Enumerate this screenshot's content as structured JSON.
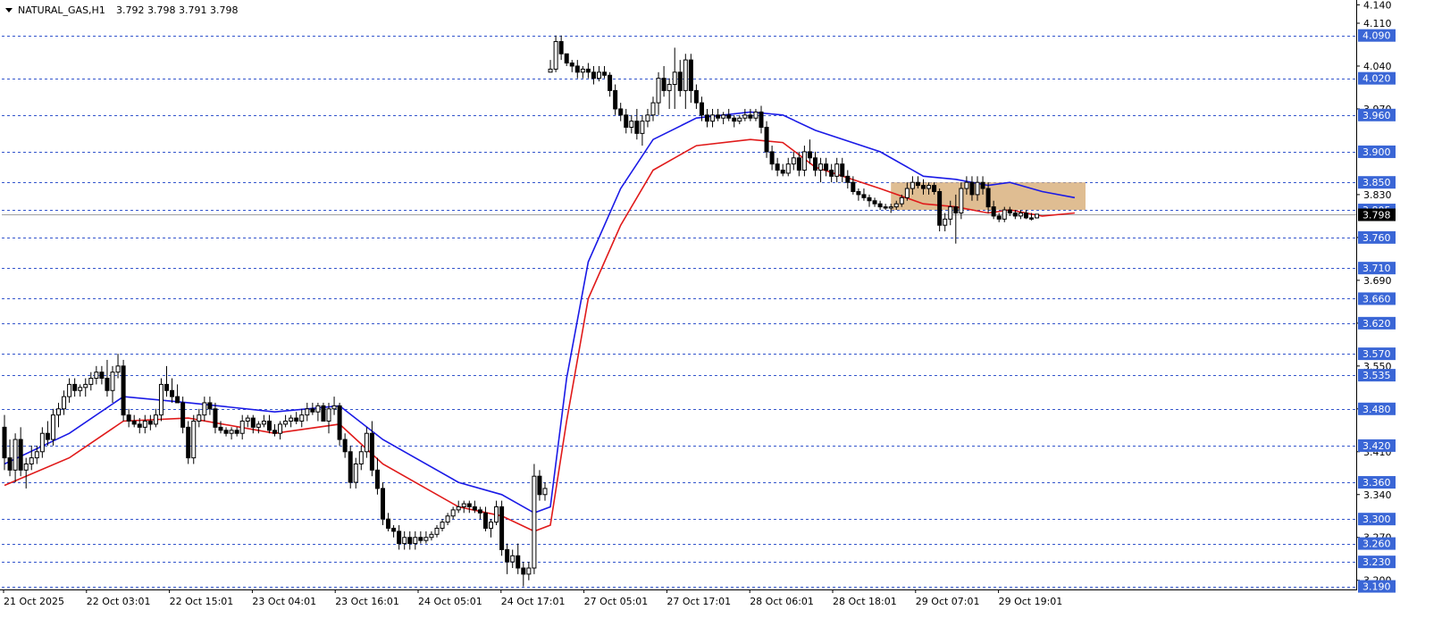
{
  "header": {
    "symbol": "NATURAL_GAS,H1",
    "ohlc": "3.792 3.798 3.791 3.798"
  },
  "colors": {
    "background": "#ffffff",
    "level_line": "#3355cc",
    "level_badge": "#3a66d6",
    "ema_fast": "#1a1ae6",
    "ema_slow": "#e01a1a",
    "zone_fill": "#d9b27f",
    "candle_bull": "#ffffff",
    "candle_bear": "#000000",
    "axis": "#000000",
    "bid_line": "#a0a0a0"
  },
  "chart_data": {
    "type": "candlestick",
    "ylim": [
      3.185,
      4.145
    ],
    "y_ticks": [
      "4.140",
      "4.110",
      "4.040",
      "3.970",
      "3.830",
      "3.760",
      "3.690",
      "3.620",
      "3.550",
      "3.480",
      "3.410",
      "3.340",
      "3.270",
      "3.200"
    ],
    "levels": [
      "4.090",
      "4.020",
      "3.960",
      "3.900",
      "3.850",
      "3.805",
      "3.760",
      "3.710",
      "3.660",
      "3.620",
      "3.570",
      "3.535",
      "3.480",
      "3.420",
      "3.360",
      "3.300",
      "3.260",
      "3.230",
      "3.190"
    ],
    "current_price": "3.798",
    "x_labels": [
      "21 Oct 2025",
      "22 Oct 03:01",
      "22 Oct 15:01",
      "23 Oct 04:01",
      "23 Oct 16:01",
      "24 Oct 05:01",
      "24 Oct 17:01",
      "27 Oct 05:01",
      "27 Oct 17:01",
      "28 Oct 06:01",
      "28 Oct 18:01",
      "29 Oct 07:01",
      "29 Oct 19:01"
    ],
    "zone": {
      "y_top": 3.85,
      "y_bottom": 3.805,
      "from_bar": 164,
      "to_bar": 200
    },
    "candles": [
      [
        3.45,
        3.47,
        3.38,
        3.4
      ],
      [
        3.4,
        3.43,
        3.37,
        3.38
      ],
      [
        3.38,
        3.44,
        3.36,
        3.43
      ],
      [
        3.43,
        3.45,
        3.37,
        3.38
      ],
      [
        3.38,
        3.4,
        3.35,
        3.39
      ],
      [
        3.39,
        3.42,
        3.38,
        3.4
      ],
      [
        3.4,
        3.42,
        3.39,
        3.41
      ],
      [
        3.41,
        3.45,
        3.4,
        3.44
      ],
      [
        3.44,
        3.46,
        3.42,
        3.43
      ],
      [
        3.43,
        3.48,
        3.42,
        3.47
      ],
      [
        3.47,
        3.49,
        3.45,
        3.48
      ],
      [
        3.48,
        3.51,
        3.47,
        3.5
      ],
      [
        3.5,
        3.53,
        3.49,
        3.52
      ],
      [
        3.52,
        3.53,
        3.5,
        3.51
      ],
      [
        3.51,
        3.52,
        3.5,
        3.515
      ],
      [
        3.515,
        3.53,
        3.5,
        3.52
      ],
      [
        3.52,
        3.54,
        3.51,
        3.53
      ],
      [
        3.53,
        3.55,
        3.52,
        3.54
      ],
      [
        3.54,
        3.55,
        3.52,
        3.53
      ],
      [
        3.53,
        3.56,
        3.5,
        3.51
      ],
      [
        3.51,
        3.55,
        3.49,
        3.54
      ],
      [
        3.54,
        3.57,
        3.53,
        3.55
      ],
      [
        3.55,
        3.56,
        3.46,
        3.47
      ],
      [
        3.47,
        3.48,
        3.45,
        3.46
      ],
      [
        3.46,
        3.47,
        3.45,
        3.455
      ],
      [
        3.455,
        3.465,
        3.44,
        3.45
      ],
      [
        3.45,
        3.47,
        3.44,
        3.46
      ],
      [
        3.46,
        3.47,
        3.445,
        3.455
      ],
      [
        3.455,
        3.48,
        3.45,
        3.47
      ],
      [
        3.47,
        3.53,
        3.46,
        3.52
      ],
      [
        3.52,
        3.55,
        3.5,
        3.51
      ],
      [
        3.51,
        3.53,
        3.49,
        3.5
      ],
      [
        3.5,
        3.52,
        3.49,
        3.49
      ],
      [
        3.49,
        3.5,
        3.44,
        3.45
      ],
      [
        3.45,
        3.46,
        3.39,
        3.4
      ],
      [
        3.4,
        3.47,
        3.39,
        3.46
      ],
      [
        3.46,
        3.48,
        3.45,
        3.47
      ],
      [
        3.47,
        3.5,
        3.46,
        3.49
      ],
      [
        3.49,
        3.5,
        3.47,
        3.48
      ],
      [
        3.48,
        3.49,
        3.44,
        3.45
      ],
      [
        3.45,
        3.46,
        3.44,
        3.445
      ],
      [
        3.445,
        3.45,
        3.435,
        3.44
      ],
      [
        3.44,
        3.45,
        3.43,
        3.445
      ],
      [
        3.445,
        3.45,
        3.435,
        3.44
      ],
      [
        3.44,
        3.47,
        3.43,
        3.46
      ],
      [
        3.46,
        3.47,
        3.45,
        3.465
      ],
      [
        3.465,
        3.47,
        3.44,
        3.45
      ],
      [
        3.45,
        3.46,
        3.44,
        3.455
      ],
      [
        3.455,
        3.47,
        3.45,
        3.46
      ],
      [
        3.46,
        3.47,
        3.44,
        3.445
      ],
      [
        3.445,
        3.455,
        3.435,
        3.44
      ],
      [
        3.44,
        3.46,
        3.43,
        3.455
      ],
      [
        3.455,
        3.47,
        3.45,
        3.46
      ],
      [
        3.46,
        3.47,
        3.45,
        3.465
      ],
      [
        3.465,
        3.475,
        3.455,
        3.46
      ],
      [
        3.46,
        3.48,
        3.45,
        3.47
      ],
      [
        3.47,
        3.49,
        3.46,
        3.48
      ],
      [
        3.48,
        3.49,
        3.47,
        3.475
      ],
      [
        3.475,
        3.49,
        3.46,
        3.485
      ],
      [
        3.485,
        3.49,
        3.46,
        3.46
      ],
      [
        3.46,
        3.49,
        3.44,
        3.48
      ],
      [
        3.48,
        3.5,
        3.47,
        3.485
      ],
      [
        3.485,
        3.49,
        3.42,
        3.43
      ],
      [
        3.43,
        3.44,
        3.4,
        3.41
      ],
      [
        3.41,
        3.42,
        3.35,
        3.36
      ],
      [
        3.36,
        3.4,
        3.35,
        3.39
      ],
      [
        3.39,
        3.42,
        3.38,
        3.41
      ],
      [
        3.41,
        3.45,
        3.4,
        3.44
      ],
      [
        3.44,
        3.46,
        3.37,
        3.38
      ],
      [
        3.38,
        3.4,
        3.34,
        3.35
      ],
      [
        3.35,
        3.36,
        3.29,
        3.3
      ],
      [
        3.3,
        3.31,
        3.28,
        3.285
      ],
      [
        3.285,
        3.29,
        3.27,
        3.28
      ],
      [
        3.28,
        3.29,
        3.25,
        3.26
      ],
      [
        3.26,
        3.28,
        3.25,
        3.27
      ],
      [
        3.27,
        3.28,
        3.25,
        3.26
      ],
      [
        3.26,
        3.28,
        3.25,
        3.27
      ],
      [
        3.27,
        3.28,
        3.26,
        3.265
      ],
      [
        3.265,
        3.28,
        3.26,
        3.27
      ],
      [
        3.27,
        3.28,
        3.265,
        3.275
      ],
      [
        3.275,
        3.29,
        3.27,
        3.285
      ],
      [
        3.285,
        3.3,
        3.28,
        3.295
      ],
      [
        3.295,
        3.31,
        3.29,
        3.305
      ],
      [
        3.305,
        3.32,
        3.3,
        3.315
      ],
      [
        3.315,
        3.33,
        3.31,
        3.32
      ],
      [
        3.32,
        3.33,
        3.31,
        3.325
      ],
      [
        3.325,
        3.33,
        3.31,
        3.32
      ],
      [
        3.32,
        3.33,
        3.31,
        3.315
      ],
      [
        3.315,
        3.32,
        3.3,
        3.31
      ],
      [
        3.31,
        3.32,
        3.28,
        3.285
      ],
      [
        3.285,
        3.3,
        3.27,
        3.295
      ],
      [
        3.295,
        3.33,
        3.29,
        3.32
      ],
      [
        3.32,
        3.33,
        3.24,
        3.25
      ],
      [
        3.25,
        3.26,
        3.21,
        3.23
      ],
      [
        3.23,
        3.25,
        3.22,
        3.24
      ],
      [
        3.24,
        3.26,
        3.21,
        3.22
      ],
      [
        3.22,
        3.23,
        3.19,
        3.21
      ],
      [
        3.21,
        3.23,
        3.2,
        3.22
      ],
      [
        3.22,
        3.39,
        3.21,
        3.37
      ],
      [
        3.37,
        3.38,
        3.33,
        3.34
      ],
      [
        3.34,
        3.36,
        3.33,
        3.35
      ],
      [
        4.03,
        4.05,
        4.03,
        4.035
      ],
      [
        4.035,
        4.09,
        4.03,
        4.08
      ],
      [
        4.08,
        4.09,
        4.05,
        4.06
      ],
      [
        4.06,
        4.06,
        4.04,
        4.045
      ],
      [
        4.045,
        4.05,
        4.03,
        4.04
      ],
      [
        4.04,
        4.05,
        4.02,
        4.03
      ],
      [
        4.03,
        4.04,
        4.02,
        4.035
      ],
      [
        4.035,
        4.045,
        4.02,
        4.03
      ],
      [
        4.03,
        4.04,
        4.01,
        4.02
      ],
      [
        4.02,
        4.04,
        4.015,
        4.03
      ],
      [
        4.03,
        4.04,
        4.02,
        4.025
      ],
      [
        4.025,
        4.03,
        3.99,
        4.0
      ],
      [
        4.0,
        4.01,
        3.96,
        3.97
      ],
      [
        3.97,
        3.98,
        3.95,
        3.96
      ],
      [
        3.96,
        3.97,
        3.93,
        3.94
      ],
      [
        3.94,
        3.96,
        3.93,
        3.95
      ],
      [
        3.95,
        3.97,
        3.92,
        3.93
      ],
      [
        3.93,
        3.96,
        3.91,
        3.95
      ],
      [
        3.95,
        3.97,
        3.94,
        3.96
      ],
      [
        3.96,
        3.99,
        3.95,
        3.98
      ],
      [
        3.98,
        4.03,
        3.96,
        4.02
      ],
      [
        4.02,
        4.04,
        3.99,
        4.0
      ],
      [
        4.0,
        4.02,
        3.97,
        4.01
      ],
      [
        4.01,
        4.07,
        3.97,
        4.03
      ],
      [
        4.03,
        4.05,
        3.99,
        4.0
      ],
      [
        4.0,
        4.06,
        3.97,
        4.05
      ],
      [
        4.05,
        4.06,
        3.98,
        4.0
      ],
      [
        4.0,
        4.01,
        3.97,
        3.98
      ],
      [
        3.98,
        3.99,
        3.95,
        3.96
      ],
      [
        3.96,
        3.97,
        3.94,
        3.95
      ],
      [
        3.95,
        3.97,
        3.94,
        3.96
      ],
      [
        3.96,
        3.97,
        3.95,
        3.955
      ],
      [
        3.955,
        3.965,
        3.945,
        3.96
      ],
      [
        3.96,
        3.97,
        3.95,
        3.955
      ],
      [
        3.955,
        3.96,
        3.94,
        3.95
      ],
      [
        3.95,
        3.96,
        3.945,
        3.955
      ],
      [
        3.955,
        3.97,
        3.95,
        3.96
      ],
      [
        3.96,
        3.97,
        3.95,
        3.955
      ],
      [
        3.955,
        3.97,
        3.95,
        3.965
      ],
      [
        3.965,
        3.975,
        3.93,
        3.94
      ],
      [
        3.94,
        3.95,
        3.89,
        3.9
      ],
      [
        3.9,
        3.91,
        3.87,
        3.88
      ],
      [
        3.88,
        3.89,
        3.86,
        3.87
      ],
      [
        3.87,
        3.88,
        3.86,
        3.865
      ],
      [
        3.865,
        3.89,
        3.86,
        3.88
      ],
      [
        3.88,
        3.9,
        3.87,
        3.89
      ],
      [
        3.89,
        3.9,
        3.86,
        3.87
      ],
      [
        3.87,
        3.91,
        3.86,
        3.9
      ],
      [
        3.9,
        3.92,
        3.88,
        3.89
      ],
      [
        3.89,
        3.9,
        3.86,
        3.87
      ],
      [
        3.87,
        3.89,
        3.85,
        3.88
      ],
      [
        3.88,
        3.89,
        3.86,
        3.87
      ],
      [
        3.87,
        3.88,
        3.85,
        3.86
      ],
      [
        3.86,
        3.89,
        3.85,
        3.88
      ],
      [
        3.88,
        3.89,
        3.85,
        3.86
      ],
      [
        3.86,
        3.87,
        3.84,
        3.85
      ],
      [
        3.85,
        3.86,
        3.83,
        3.835
      ],
      [
        3.835,
        3.84,
        3.82,
        3.83
      ],
      [
        3.83,
        3.84,
        3.82,
        3.825
      ],
      [
        3.825,
        3.83,
        3.81,
        3.82
      ],
      [
        3.82,
        3.825,
        3.81,
        3.815
      ],
      [
        3.815,
        3.82,
        3.805,
        3.81
      ],
      [
        3.81,
        3.815,
        3.805,
        3.808
      ],
      [
        3.808,
        3.815,
        3.8,
        3.81
      ],
      [
        3.81,
        3.82,
        3.805,
        3.815
      ],
      [
        3.815,
        3.83,
        3.81,
        3.825
      ],
      [
        3.825,
        3.85,
        3.82,
        3.84
      ],
      [
        3.84,
        3.86,
        3.83,
        3.85
      ],
      [
        3.85,
        3.86,
        3.84,
        3.845
      ],
      [
        3.845,
        3.855,
        3.83,
        3.84
      ],
      [
        3.84,
        3.85,
        3.83,
        3.845
      ],
      [
        3.845,
        3.85,
        3.83,
        3.835
      ],
      [
        3.835,
        3.84,
        3.77,
        3.78
      ],
      [
        3.78,
        3.8,
        3.77,
        3.79
      ],
      [
        3.79,
        3.82,
        3.78,
        3.81
      ],
      [
        3.81,
        3.83,
        3.75,
        3.8
      ],
      [
        3.8,
        3.85,
        3.79,
        3.84
      ],
      [
        3.84,
        3.86,
        3.83,
        3.85
      ],
      [
        3.85,
        3.86,
        3.82,
        3.83
      ],
      [
        3.83,
        3.86,
        3.82,
        3.85
      ],
      [
        3.85,
        3.86,
        3.83,
        3.84
      ],
      [
        3.84,
        3.85,
        3.8,
        3.81
      ],
      [
        3.81,
        3.82,
        3.79,
        3.795
      ],
      [
        3.795,
        3.8,
        3.785,
        3.79
      ],
      [
        3.79,
        3.81,
        3.785,
        3.805
      ],
      [
        3.805,
        3.81,
        3.795,
        3.8
      ],
      [
        3.8,
        3.805,
        3.79,
        3.795
      ],
      [
        3.795,
        3.805,
        3.79,
        3.8
      ],
      [
        3.8,
        3.805,
        3.79,
        3.792
      ],
      [
        3.792,
        3.8,
        3.788,
        3.79
      ],
      [
        3.792,
        3.798,
        3.791,
        3.798
      ]
    ],
    "ema_fast": [
      [
        0,
        3.39
      ],
      [
        12,
        3.44
      ],
      [
        22,
        3.5
      ],
      [
        34,
        3.49
      ],
      [
        50,
        3.475
      ],
      [
        62,
        3.485
      ],
      [
        70,
        3.43
      ],
      [
        84,
        3.36
      ],
      [
        92,
        3.34
      ],
      [
        98,
        3.31
      ],
      [
        101,
        3.32
      ],
      [
        104,
        3.53
      ],
      [
        108,
        3.72
      ],
      [
        114,
        3.84
      ],
      [
        120,
        3.92
      ],
      [
        128,
        3.955
      ],
      [
        138,
        3.965
      ],
      [
        144,
        3.96
      ],
      [
        150,
        3.935
      ],
      [
        162,
        3.9
      ],
      [
        170,
        3.86
      ],
      [
        176,
        3.855
      ],
      [
        182,
        3.845
      ],
      [
        186,
        3.85
      ],
      [
        192,
        3.835
      ],
      [
        198,
        3.825
      ]
    ],
    "ema_slow": [
      [
        0,
        3.355
      ],
      [
        12,
        3.4
      ],
      [
        22,
        3.46
      ],
      [
        34,
        3.465
      ],
      [
        50,
        3.44
      ],
      [
        62,
        3.455
      ],
      [
        70,
        3.39
      ],
      [
        84,
        3.32
      ],
      [
        92,
        3.305
      ],
      [
        98,
        3.28
      ],
      [
        101,
        3.29
      ],
      [
        104,
        3.46
      ],
      [
        108,
        3.66
      ],
      [
        114,
        3.78
      ],
      [
        120,
        3.87
      ],
      [
        128,
        3.91
      ],
      [
        138,
        3.92
      ],
      [
        144,
        3.915
      ],
      [
        150,
        3.875
      ],
      [
        162,
        3.84
      ],
      [
        170,
        3.815
      ],
      [
        176,
        3.81
      ],
      [
        182,
        3.8
      ],
      [
        186,
        3.805
      ],
      [
        192,
        3.795
      ],
      [
        198,
        3.8
      ]
    ]
  }
}
